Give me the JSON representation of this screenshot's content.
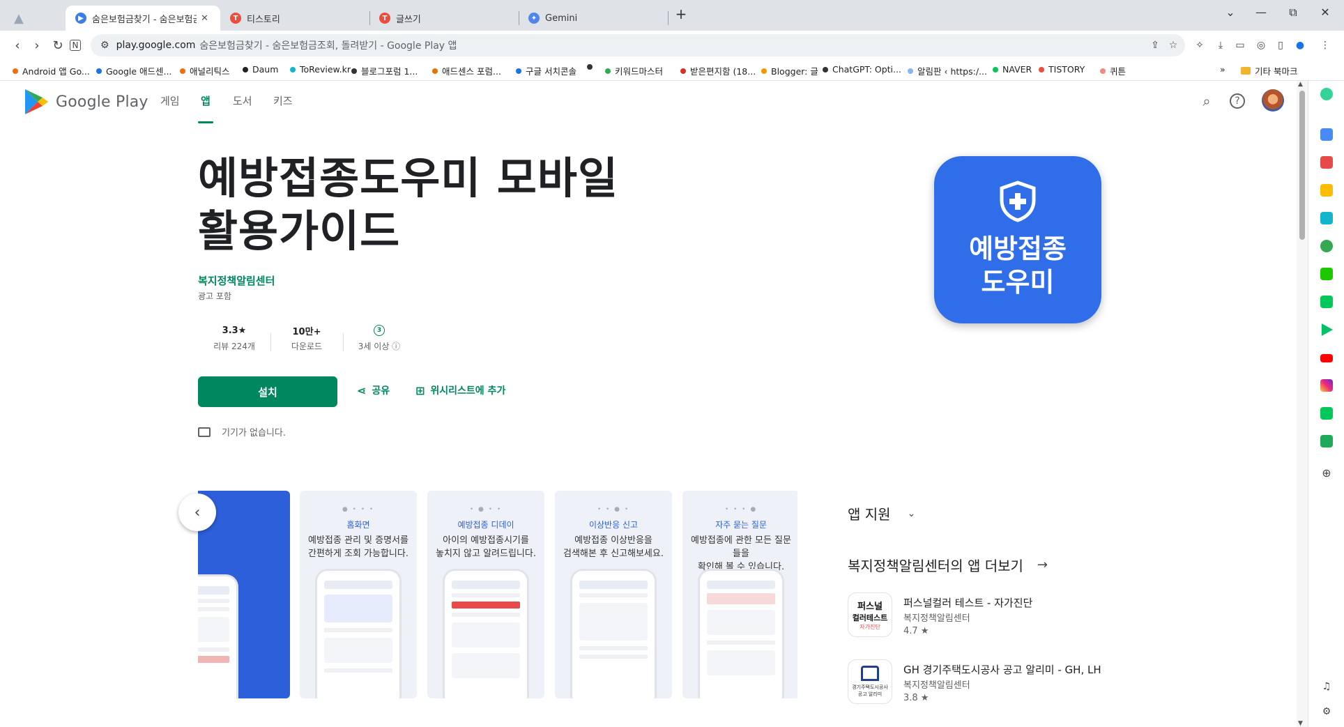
{
  "tabs": [
    {
      "title": "숨은보험금찾기 - 숨은보험금조회",
      "color": "#3b7de9",
      "mark": "▶",
      "active": true
    },
    {
      "title": "티스토리",
      "color": "#eb4e3d",
      "mark": "T",
      "active": false
    },
    {
      "title": "글쓰기",
      "color": "#eb4e3d",
      "mark": "T",
      "active": false
    },
    {
      "title": "Gemini",
      "color": "#4f86ec",
      "mark": "✦",
      "active": false
    }
  ],
  "window_controls": {
    "new_tab": "+",
    "dropdown": "⌄",
    "minimize": "—",
    "restore": "⧉",
    "close": "✕"
  },
  "address": {
    "domain": "play.google.com",
    "page_title": "숨은보험금찾기 - 숨은보험금조회, 돌려받기 - Google Play 앱"
  },
  "bookmarks": [
    {
      "label": "Android 앱 Go...",
      "color": "#e8710a"
    },
    {
      "label": "Google 애드센...",
      "color": "#1a73e8"
    },
    {
      "label": "애널리틱스",
      "color": "#e8710a"
    },
    {
      "label": "Daum",
      "color": "#202124"
    },
    {
      "label": "ToReview.kr",
      "color": "#12b5cb"
    },
    {
      "label": "블로그포럼 1...",
      "color": "#333"
    },
    {
      "label": "애드센스 포럼...",
      "color": "#e37400"
    },
    {
      "label": "구글 서치콘솔",
      "color": "#1a73e8"
    },
    {
      "label": "",
      "color": "#333"
    },
    {
      "label": "키워드마스터",
      "color": "#34a853"
    },
    {
      "label": "받은편지함 (18...",
      "color": "#d93025"
    },
    {
      "label": "Blogger: 글",
      "color": "#f29900"
    },
    {
      "label": "ChatGPT: Opti...",
      "color": "#333"
    },
    {
      "label": "알림판 ‹ https:/...",
      "color": "#8ab4f8"
    },
    {
      "label": "NAVER",
      "color": "#03c75a"
    },
    {
      "label": "TISTORY",
      "color": "#eb4e3d"
    },
    {
      "label": "퀴튼",
      "color": "#f28b82"
    }
  ],
  "bookmarks_more": "»",
  "bookmarks_other": "기타 북마크",
  "store": {
    "logo_text": "Google Play",
    "nav": [
      "게임",
      "앱",
      "도서",
      "키즈"
    ]
  },
  "app": {
    "title_line1": "예방접종도우미 모바일",
    "title_line2": "활용가이드",
    "developer": "복지정책알림센터",
    "ads": "광고 포함",
    "rating": "3.3★",
    "reviews": "리뷰 224개",
    "downloads": "10만+",
    "downloads_label": "다운로드",
    "age_badge": "3",
    "age_label": "3세 이상 ⓘ",
    "install": "설치",
    "share": "공유",
    "wishlist": "위시리스트에 추가",
    "no_device": "기기가 없습니다.",
    "icon_text_line1": "예방접종",
    "icon_text_line2": "도우미",
    "brand_color": "#2f6ee8"
  },
  "screenshots": [
    {
      "category": "",
      "desc_line1": "",
      "desc_line2": ""
    },
    {
      "category": "홈화면",
      "desc_line1": "예방접종 관리 및 증명서를",
      "desc_line2": "간편하게 조회 가능합니다."
    },
    {
      "category": "예방접종 디데이",
      "desc_line1": "아이의 예방접종시기를",
      "desc_line2": "놓치지 않고 알려드립니다."
    },
    {
      "category": "이상반응 신고",
      "desc_line1": "예방접종 이상반응을",
      "desc_line2": "검색해본 후 신고해보세요."
    },
    {
      "category": "자주 묻는 질문",
      "desc_line1": "예방접종에 관한 모든 질문들을",
      "desc_line2": "확인해 볼 수 있습니다."
    }
  ],
  "support_label": "앱 지원",
  "more_from": "복지정책알림센터의 앱 더보기",
  "related": [
    {
      "name": "퍼스널컬러 테스트 - 자가진단",
      "developer": "복지정책알림센터",
      "rating": "4.7 ★",
      "icon_line1": "퍼스널",
      "icon_line2": "컬러테스트",
      "icon_line3": "자가진단"
    },
    {
      "name": "GH 경기주택도시공사 공고 알리미 - GH, LH",
      "developer": "복지정책알림센터",
      "rating": "3.8 ★",
      "icon_line1": "경기주택도시공사",
      "icon_line2": "공고 알리미",
      "icon_line3": ""
    }
  ]
}
